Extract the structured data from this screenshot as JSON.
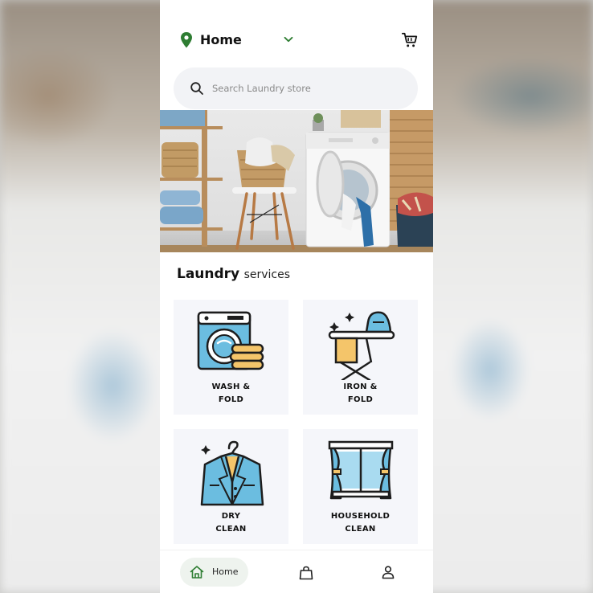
{
  "header": {
    "location_label": "Home",
    "location_icon": "map-pin-icon",
    "dropdown_icon": "chevron-down-icon",
    "cart_icon": "cart-icon",
    "accent_color": "#2e7d32"
  },
  "search": {
    "placeholder": "Search Laundry store",
    "icon": "search-icon"
  },
  "banner": {
    "image": "laundry-room-photo"
  },
  "services": {
    "title_bold": "Laundry",
    "title_light": "services",
    "items": [
      {
        "line1": "WASH &",
        "line2": "FOLD",
        "icon": "washing-machine-icon"
      },
      {
        "line1": "IRON &",
        "line2": "FOLD",
        "icon": "iron-board-icon"
      },
      {
        "line1": "DRY",
        "line2": "CLEAN",
        "icon": "suit-hanger-icon"
      },
      {
        "line1": "HOUSEHOLD",
        "line2": "CLEAN",
        "icon": "curtain-window-icon"
      }
    ]
  },
  "bottom_nav": {
    "items": [
      {
        "label": "Home",
        "icon": "home-icon",
        "active": true
      },
      {
        "label": "",
        "icon": "shopping-bag-icon",
        "active": false
      },
      {
        "label": "",
        "icon": "user-icon",
        "active": false
      }
    ]
  }
}
